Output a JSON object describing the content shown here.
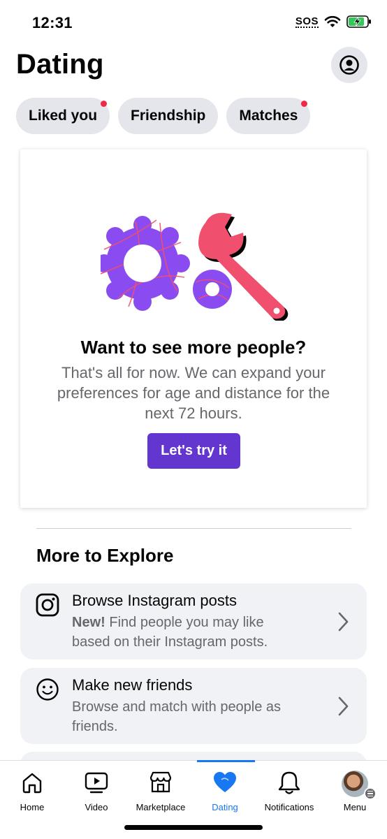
{
  "status_bar": {
    "time": "12:31",
    "sos": "SOS"
  },
  "header": {
    "title": "Dating"
  },
  "chips": [
    {
      "label": "Liked you",
      "has_dot": true
    },
    {
      "label": "Friendship",
      "has_dot": false
    },
    {
      "label": "Matches",
      "has_dot": true
    }
  ],
  "card": {
    "title": "Want to see more people?",
    "body": "That's all for now. We can expand your preferences for age and distance for the next 72 hours.",
    "cta": "Let's try it"
  },
  "explore": {
    "title": "More to Explore",
    "items": [
      {
        "icon": "instagram-icon",
        "title": "Browse Instagram posts",
        "desc_bold": "New!",
        "desc": "Find people you may like based on their Instagram posts."
      },
      {
        "icon": "smiley-icon",
        "title": "Make new friends",
        "desc_bold": "",
        "desc": "Browse and match with people as friends."
      }
    ]
  },
  "bottom_nav": [
    {
      "label": "Home",
      "icon": "home-icon"
    },
    {
      "label": "Video",
      "icon": "video-icon"
    },
    {
      "label": "Marketplace",
      "icon": "marketplace-icon"
    },
    {
      "label": "Dating",
      "icon": "heart-icon",
      "active": true
    },
    {
      "label": "Notifications",
      "icon": "bell-icon"
    },
    {
      "label": "Menu",
      "icon": "avatar"
    }
  ],
  "colors": {
    "accent": "#6436d0",
    "nav_active": "#1877f2",
    "notification_dot": "#f02849",
    "chip_bg": "#e4e6eb",
    "illustration_gear": "#8a4cf0",
    "illustration_wrench": "#f0506e"
  }
}
